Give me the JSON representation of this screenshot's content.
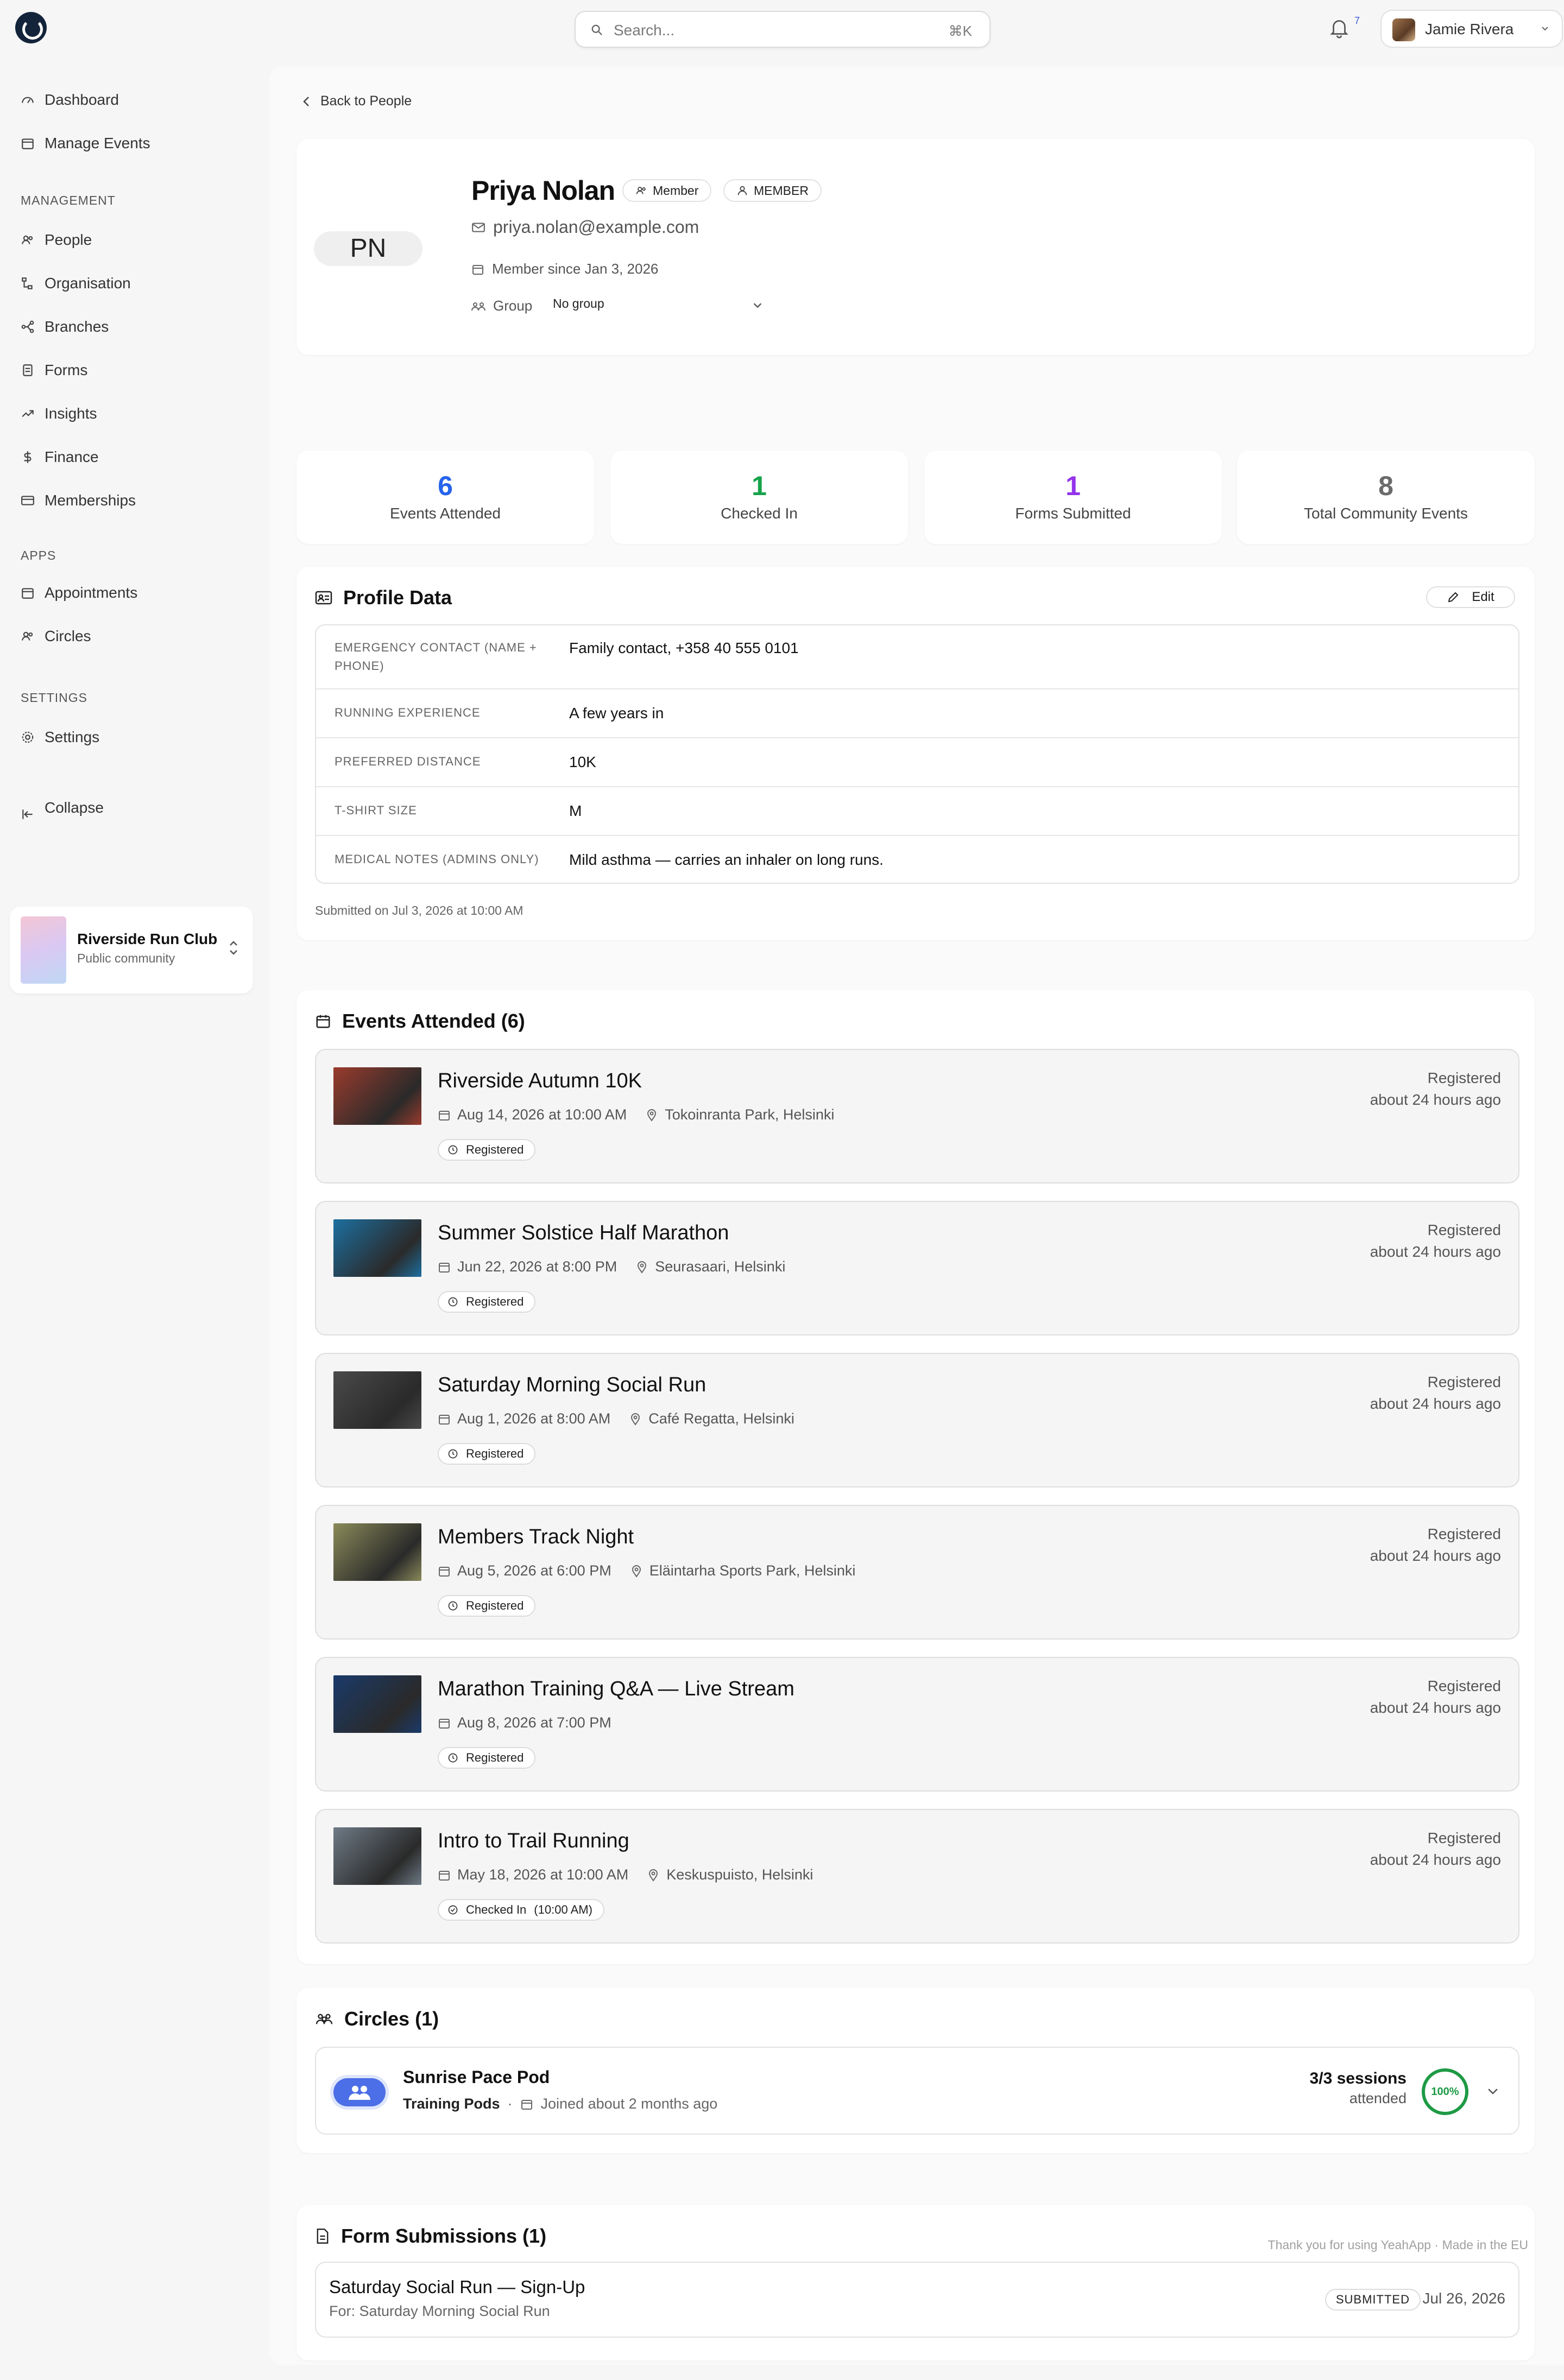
{
  "topbar": {
    "search_placeholder": "Search...",
    "search_shortcut": "⌘K",
    "notification_count": "7",
    "user_name": "Jamie Rivera"
  },
  "sidebar": {
    "top_items": [
      {
        "label": "Dashboard",
        "icon": "gauge-icon"
      },
      {
        "label": "Manage Events",
        "icon": "calendar-icon"
      }
    ],
    "management_title": "MANAGEMENT",
    "management_items": [
      {
        "label": "People",
        "icon": "people-icon"
      },
      {
        "label": "Organisation",
        "icon": "org-icon"
      },
      {
        "label": "Branches",
        "icon": "branches-icon"
      },
      {
        "label": "Forms",
        "icon": "form-icon"
      },
      {
        "label": "Insights",
        "icon": "trend-icon"
      },
      {
        "label": "Finance",
        "icon": "dollar-icon"
      },
      {
        "label": "Memberships",
        "icon": "card-icon"
      }
    ],
    "apps_title": "APPS",
    "apps_items": [
      {
        "label": "Appointments",
        "icon": "calendar-icon"
      },
      {
        "label": "Circles",
        "icon": "people-icon"
      }
    ],
    "settings_title": "SETTINGS",
    "settings_items": [
      {
        "label": "Settings",
        "icon": "gear-icon"
      }
    ],
    "collapse_label": "Collapse",
    "club": {
      "name": "Riverside Run Club",
      "subtitle": "Public community"
    }
  },
  "main": {
    "back_label": "Back to People",
    "profile": {
      "initials": "PN",
      "name": "Priya Nolan",
      "chip_member": "Member",
      "chip_role": "MEMBER",
      "email": "priya.nolan@example.com",
      "member_since": "Member since Jan 3, 2026",
      "group_label": "Group",
      "group_value": "No group"
    },
    "stats": [
      {
        "value": "6",
        "label": "Events Attended",
        "color": "#2563eb"
      },
      {
        "value": "1",
        "label": "Checked In",
        "color": "#16a34a"
      },
      {
        "value": "1",
        "label": "Forms Submitted",
        "color": "#9333ea"
      },
      {
        "value": "8",
        "label": "Total Community Events",
        "color": "#6b6b6b"
      }
    ],
    "profile_data": {
      "title": "Profile Data",
      "edit_label": "Edit",
      "rows": [
        {
          "key": "EMERGENCY CONTACT (NAME + PHONE)",
          "value": "Family contact, +358 40 555 0101"
        },
        {
          "key": "RUNNING EXPERIENCE",
          "value": "A few years in"
        },
        {
          "key": "PREFERRED DISTANCE",
          "value": "10K"
        },
        {
          "key": "T-SHIRT SIZE",
          "value": "M"
        },
        {
          "key": "MEDICAL NOTES (ADMINS ONLY)",
          "value": "Mild asthma — carries an inhaler on long runs."
        }
      ],
      "submitted_on": "Submitted on Jul 3, 2026 at 10:00 AM"
    },
    "events": {
      "title": "Events Attended (6)",
      "items": [
        {
          "title": "Riverside Autumn 10K",
          "date": "Aug 14, 2026 at 10:00 AM",
          "location": "Tokoinranta Park, Helsinki",
          "badge": "Registered",
          "badge_extra": "",
          "status": "Registered",
          "when": "about 24 hours ago",
          "thumb_color": "#9a3b2d"
        },
        {
          "title": "Summer Solstice Half Marathon",
          "date": "Jun 22, 2026 at 8:00 PM",
          "location": "Seurasaari, Helsinki",
          "badge": "Registered",
          "badge_extra": "",
          "status": "Registered",
          "when": "about 24 hours ago",
          "thumb_color": "#1d6fa0"
        },
        {
          "title": "Saturday Morning Social Run",
          "date": "Aug 1, 2026 at 8:00 AM",
          "location": "Café Regatta, Helsinki",
          "badge": "Registered",
          "badge_extra": "",
          "status": "Registered",
          "when": "about 24 hours ago",
          "thumb_color": "#4a4a4a"
        },
        {
          "title": "Members Track Night",
          "date": "Aug 5, 2026 at 6:00 PM",
          "location": "Eläintarha Sports Park, Helsinki",
          "badge": "Registered",
          "badge_extra": "",
          "status": "Registered",
          "when": "about 24 hours ago",
          "thumb_color": "#8a8a5a"
        },
        {
          "title": "Marathon Training Q&A — Live Stream",
          "date": "Aug 8, 2026 at 7:00 PM",
          "location": "",
          "badge": "Registered",
          "badge_extra": "",
          "status": "Registered",
          "when": "about 24 hours ago",
          "thumb_color": "#1a3a6a"
        },
        {
          "title": "Intro to Trail Running",
          "date": "May 18, 2026 at 10:00 AM",
          "location": "Keskuspuisto, Helsinki",
          "badge": "Checked In",
          "badge_extra": "(10:00 AM)",
          "status": "Registered",
          "when": "about 24 hours ago",
          "thumb_color": "#6e7a86"
        }
      ]
    },
    "circles": {
      "title": "Circles (1)",
      "name": "Sunrise Pace Pod",
      "type": "Training Pods",
      "joined": "Joined about 2 months ago",
      "sessions": "3/3 sessions",
      "sessions_sub": "attended",
      "percent": "100%"
    },
    "forms": {
      "title": "Form Submissions (1)",
      "form_title": "Saturday Social Run — Sign-Up",
      "form_for": "For: Saturday Morning Social Run",
      "badge": "SUBMITTED",
      "date": "Jul 26, 2026"
    },
    "footer": "Thank you for using YeahApp · Made in the EU"
  }
}
